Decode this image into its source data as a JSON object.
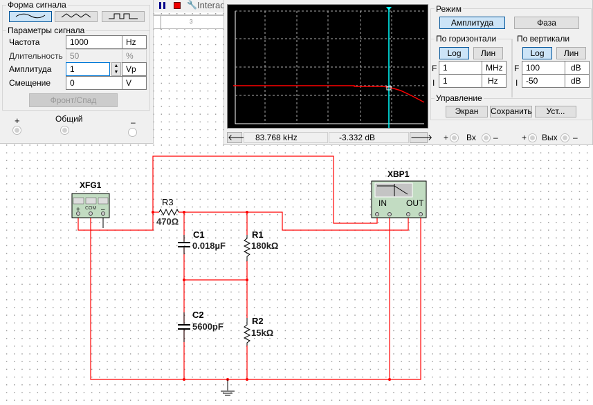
{
  "toolbar": {
    "interactive_label": "Interac",
    "ruler_mark": "3"
  },
  "function_generator": {
    "waveform_group": "Форма сигнала",
    "waveforms": [
      "sine",
      "triangle",
      "square"
    ],
    "selected_waveform": "sine",
    "params_group": "Параметры сигнала",
    "frequency": {
      "label": "Частота",
      "value": "1000",
      "unit": "Hz"
    },
    "duty_cycle": {
      "label": "Длительность",
      "value": "50",
      "unit": "%"
    },
    "amplitude": {
      "label": "Амплитуда",
      "value": "1",
      "unit": "Vp"
    },
    "offset": {
      "label": "Смещение",
      "value": "0",
      "unit": "V"
    },
    "rise_fall_button": "Фронт/Спад",
    "terminal_plus": "+",
    "terminal_common": "Общий",
    "terminal_minus": "–"
  },
  "bode_plotter": {
    "readout_frequency": "83.768 kHz",
    "readout_value": "-3.332 dB",
    "mode_group": "Режим",
    "mode_magnitude": "Амплитуда",
    "mode_phase": "Фаза",
    "selected_mode": "Амплитуда",
    "horizontal": {
      "label": "По горизонтали",
      "log": "Log",
      "lin": "Лин",
      "selected": "Log",
      "F_label": "F",
      "F_value": "1",
      "F_unit": "MHz",
      "I_label": "I",
      "I_value": "1",
      "I_unit": "Hz"
    },
    "vertical": {
      "label": "По вертикали",
      "log": "Log",
      "lin": "Лин",
      "selected": "Log",
      "F_label": "F",
      "F_value": "100",
      "F_unit": "dB",
      "I_label": "I",
      "I_value": "-50",
      "I_unit": "dB"
    },
    "controls_group": "Управление",
    "screen_button": "Экран",
    "save_button": "Сохранить",
    "settings_button": "Уст...",
    "in_label": "Вх",
    "out_label": "Вых",
    "plus": "+",
    "minus": "–",
    "trace_color": "#ff0000",
    "cursor_color": "#00ffff"
  },
  "schematic": {
    "xfg1": {
      "name": "XFG1",
      "com": "COM",
      "plus": "+",
      "minus": "–"
    },
    "xbp1": {
      "name": "XBP1",
      "in": "IN",
      "out": "OUT",
      "plus": "+",
      "minus": "–"
    },
    "r3": {
      "name": "R3",
      "value": "470Ω"
    },
    "c1": {
      "name": "C1",
      "value": "0.018µF"
    },
    "r1": {
      "name": "R1",
      "value": "180kΩ"
    },
    "c2": {
      "name": "C2",
      "value": "5600pF"
    },
    "r2": {
      "name": "R2",
      "value": "15kΩ"
    },
    "wire_color": "#ff0000"
  }
}
